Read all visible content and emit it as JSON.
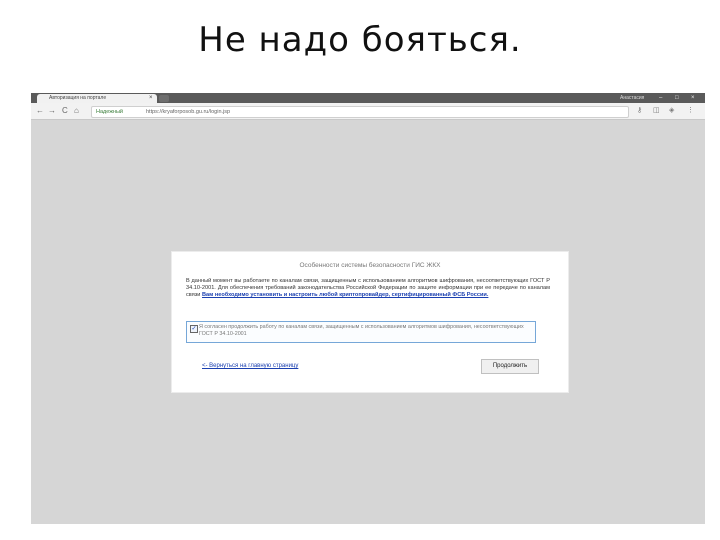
{
  "slide": {
    "title": "Не надо бояться."
  },
  "browser": {
    "tab_title": "Авторизация на портале",
    "tab_close": "×",
    "profile_label": "Анастасия",
    "window_controls": [
      "–",
      "□",
      "×"
    ],
    "nav": {
      "back": "←",
      "forward": "→",
      "reload": "C",
      "home": "⌂"
    },
    "address": {
      "secure_label": "Надежный",
      "url": "https://kryaforposob.gu.ru/login.jsp"
    },
    "star_icon": "star-icon",
    "extension_icons": [
      "key-icon",
      "extension-icon",
      "shield-icon",
      "menu-icon"
    ]
  },
  "dialog": {
    "title": "Особенности системы безопасности ГИС ЖКХ",
    "message": "В данный момент вы работаете по каналам связи, защищенным с использованием алгоритмов шифрования, несоответствующих ГОСТ Р 34.10-2001. Для обеспечения требований законодательства Российской Федерации по защите информации при ее передаче по каналам связи",
    "message_link": "Вам необходимо установить и настроить любой криптопровайдер, сертифицированный ФСБ России.",
    "consent_text": "Я согласен продолжить работу по каналам связи, защищенным с использованием алгоритмов шифрования, несоответствующих ГОСТ Р 34.10-2001",
    "consent_checked": true,
    "back_link": "<- Вернуться на главную страницу",
    "continue_button": "Продолжить"
  },
  "colors": {
    "background": "#d6d6d6",
    "link": "#1a3fb0",
    "consent_border": "#76a7d8"
  }
}
